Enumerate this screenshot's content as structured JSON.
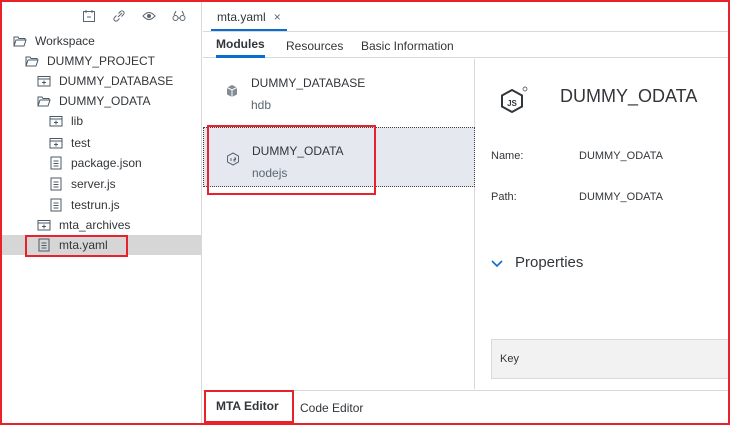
{
  "explorer": {
    "toolbar_icons": [
      "collapse-icon",
      "link-icon",
      "eye-icon",
      "binoculars-icon"
    ],
    "tree": [
      {
        "label": "Workspace",
        "icon": "folder-open-icon",
        "depth": 0
      },
      {
        "label": "DUMMY_PROJECT",
        "icon": "folder-open-icon",
        "depth": 1
      },
      {
        "label": "DUMMY_DATABASE",
        "icon": "module-folder-icon",
        "depth": 2
      },
      {
        "label": "DUMMY_ODATA",
        "icon": "folder-open-icon",
        "depth": 2
      },
      {
        "label": "lib",
        "icon": "module-folder-icon",
        "depth": 3
      },
      {
        "label": "test",
        "icon": "module-folder-icon",
        "depth": 3
      },
      {
        "label": "package.json",
        "icon": "file-icon",
        "depth": 3
      },
      {
        "label": "server.js",
        "icon": "file-icon",
        "depth": 3
      },
      {
        "label": "testrun.js",
        "icon": "file-icon",
        "depth": 3
      },
      {
        "label": "mta_archives",
        "icon": "module-folder-icon",
        "depth": 2
      },
      {
        "label": "mta.yaml",
        "icon": "file-icon",
        "depth": 2,
        "selected": true
      }
    ]
  },
  "editor": {
    "file_tab": "mta.yaml",
    "file_tab_close": "×",
    "subtabs": [
      "Modules",
      "Resources",
      "Basic Information"
    ],
    "active_subtab": "Modules",
    "modules": [
      {
        "name": "DUMMY_DATABASE",
        "type": "hdb"
      },
      {
        "name": "DUMMY_ODATA",
        "type": "nodejs",
        "selected": true
      }
    ],
    "detail": {
      "title": "DUMMY_ODATA",
      "name_label": "Name:",
      "name_value": "DUMMY_ODATA",
      "path_label": "Path:",
      "path_value": "DUMMY_ODATA",
      "properties_label": "Properties",
      "key_header": "Key"
    },
    "bottom_tabs": [
      "MTA Editor",
      "Code Editor"
    ],
    "active_bottom_tab": "MTA Editor"
  },
  "colors": {
    "accent": "#0a6ed1",
    "callout": "#e8212a",
    "selected_row": "#d6d6d6",
    "selected_module": "#e5e9ef"
  }
}
